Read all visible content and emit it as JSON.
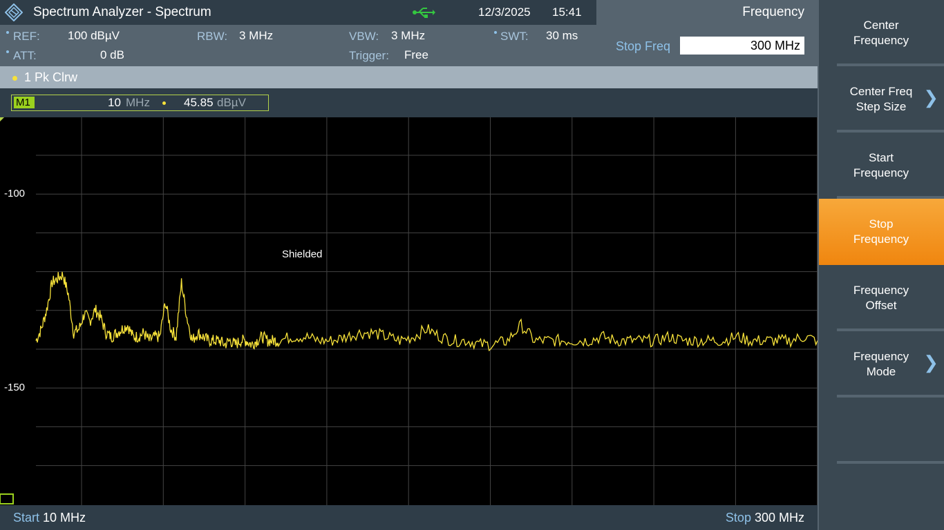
{
  "header": {
    "app_title": "Spectrum Analyzer - Spectrum",
    "date": "12/3/2025",
    "time": "15:41",
    "menu_title": "Frequency",
    "usb_icon": "usb-icon",
    "logo_icon": "rohde-schwarz-logo"
  },
  "settings": {
    "ref_label": "REF:",
    "ref_value": "100 dBµV",
    "att_label": "ATT:",
    "att_value": "0 dB",
    "rbw_label": "RBW:",
    "rbw_value": "3 MHz",
    "vbw_label": "VBW:",
    "vbw_value": "3 MHz",
    "trigger_label": "Trigger:",
    "trigger_value": "Free",
    "swt_label": "SWT:",
    "swt_value": "30 ms"
  },
  "entry": {
    "label": "Stop Freq",
    "value": "300 MHz"
  },
  "trace": {
    "label": "1 Pk  Clrw",
    "color": "#f7e23a"
  },
  "marker": {
    "tag": "M1",
    "freq": "10",
    "freq_unit": "MHz",
    "level": "45.85",
    "level_unit": "dBµV"
  },
  "plot": {
    "annotation": "Shielded",
    "y_tick_labels": [
      "-100",
      "-150"
    ]
  },
  "footer": {
    "start_label": "Start",
    "start_value": "10 MHz",
    "stop_label": "Stop",
    "stop_value": "300 MHz"
  },
  "softkeys": [
    {
      "label": "Center\nFrequency",
      "has_submenu": false,
      "active": false
    },
    {
      "label": "Center Freq\nStep Size",
      "has_submenu": true,
      "active": false
    },
    {
      "label": "Start\nFrequency",
      "has_submenu": false,
      "active": false
    },
    {
      "label": "Stop\nFrequency",
      "has_submenu": false,
      "active": true
    },
    {
      "label": "Frequency\nOffset",
      "has_submenu": false,
      "active": false
    },
    {
      "label": "Frequency\nMode",
      "has_submenu": true,
      "active": false
    },
    {
      "label": "",
      "has_submenu": false,
      "active": false
    }
  ],
  "chart_data": {
    "type": "line",
    "x_range": [
      10,
      300
    ],
    "x_unit": "MHz",
    "ylim": [
      -180,
      -80
    ],
    "y_ticks": [
      -100,
      -150
    ],
    "grid": true,
    "series": [
      {
        "color": "#f7e23a",
        "x": [
          10,
          12,
          14,
          16,
          18,
          20,
          22,
          24,
          26,
          28,
          30,
          32,
          34,
          36,
          38,
          40,
          42,
          44,
          46,
          48,
          50,
          52,
          54,
          56,
          58,
          60,
          62,
          64,
          66,
          68,
          70,
          72,
          74,
          76,
          78,
          80,
          82,
          84,
          86,
          88,
          90,
          92,
          94,
          96,
          98,
          100,
          105,
          110,
          115,
          120,
          125,
          130,
          135,
          140,
          145,
          150,
          155,
          160,
          165,
          170,
          175,
          180,
          185,
          190,
          195,
          200,
          205,
          210,
          215,
          220,
          225,
          230,
          235,
          240,
          245,
          250,
          255,
          260,
          265,
          270,
          275,
          280,
          285,
          290,
          295,
          300
        ],
        "y": [
          -138,
          -135,
          -130,
          -123,
          -122,
          -121,
          -126,
          -136,
          -135,
          -131,
          -133,
          -130,
          -132,
          -136,
          -137,
          -136,
          -135,
          -134,
          -137,
          -137,
          -136,
          -138,
          -137,
          -137,
          -128,
          -135,
          -137,
          -123,
          -132,
          -138,
          -136,
          -137,
          -138,
          -138,
          -138,
          -139,
          -138,
          -139,
          -138,
          -138,
          -139,
          -138,
          -137,
          -138,
          -138,
          -138,
          -137,
          -137,
          -138,
          -138,
          -137,
          -136,
          -136,
          -137,
          -138,
          -137,
          -135,
          -137,
          -138,
          -138,
          -139,
          -139,
          -138,
          -134,
          -138,
          -138,
          -138,
          -138,
          -138,
          -137,
          -138,
          -138,
          -138,
          -138,
          -137,
          -138,
          -138,
          -138,
          -138,
          -137,
          -138,
          -138,
          -138,
          -138,
          -137,
          -138
        ]
      }
    ]
  }
}
